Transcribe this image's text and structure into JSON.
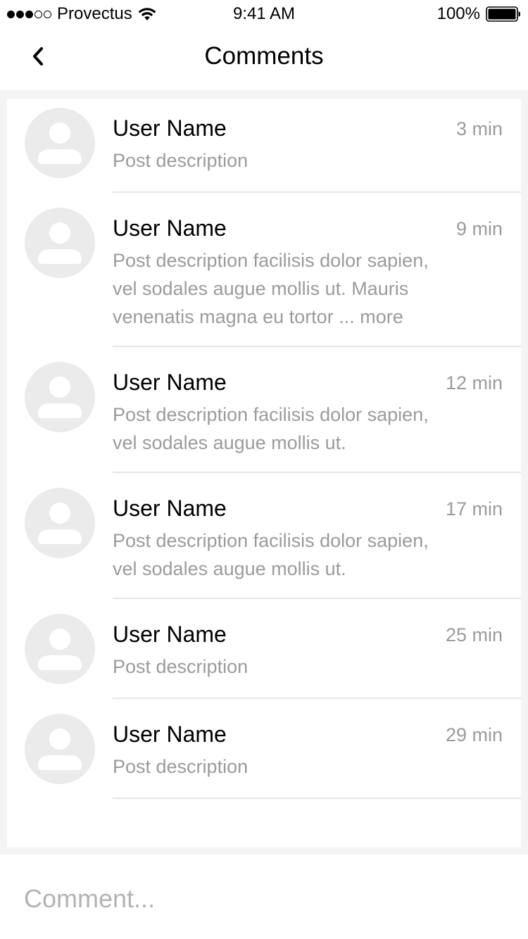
{
  "status_bar": {
    "carrier": "Provectus",
    "time": "9:41 AM",
    "battery": "100%",
    "signal_bars_filled": 3,
    "signal_bars_total": 5,
    "icons": [
      "signal-dots-icon",
      "wifi-icon",
      "battery-icon"
    ]
  },
  "nav": {
    "title": "Comments",
    "back_icon": "chevron-left-icon"
  },
  "comments": [
    {
      "user": "User Name",
      "time": "3 min",
      "lines": [
        "Post description"
      ],
      "more": ""
    },
    {
      "user": "User Name",
      "time": "9 min",
      "lines": [
        "Post description facilisis dolor sapien,",
        "vel sodales augue mollis ut. Mauris",
        "venenatis magna eu tortor ... "
      ],
      "more": "more"
    },
    {
      "user": "User Name",
      "time": "12 min",
      "lines": [
        "Post description facilisis dolor sapien,",
        "vel sodales augue mollis ut."
      ],
      "more": ""
    },
    {
      "user": "User Name",
      "time": "17 min",
      "lines": [
        "Post description facilisis dolor sapien,",
        "vel sodales augue mollis ut."
      ],
      "more": ""
    },
    {
      "user": "User Name",
      "time": "25 min",
      "lines": [
        "Post description"
      ],
      "more": ""
    },
    {
      "user": "User Name",
      "time": "29 min",
      "lines": [
        "Post description"
      ],
      "more": ""
    }
  ],
  "comment_input": {
    "placeholder": "Comment...",
    "value": ""
  },
  "colors": {
    "background_frame": "#f4f4f4",
    "secondary_text": "#9b9b9b",
    "avatar_bg": "#ebebeb",
    "divider": "#e6e6e6"
  }
}
